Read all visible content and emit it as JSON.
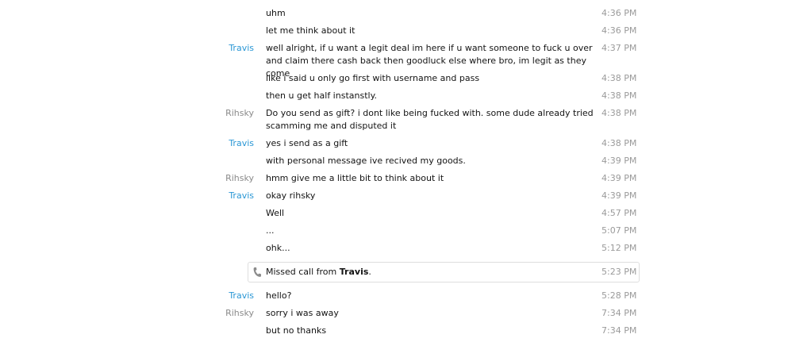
{
  "messages": [
    {
      "sender": "",
      "text": "uhm",
      "time": "4:36 PM"
    },
    {
      "sender": "",
      "text": "let me think about it",
      "time": "4:36 PM"
    },
    {
      "sender": "Travis",
      "text": "well alright, if u want a legit deal im here if u want someone to fuck u over and claim there cash back then goodluck else where bro, im legit as they come",
      "time": "4:37 PM"
    },
    {
      "sender": "",
      "text": "like i said u only go first with username and pass",
      "time": "4:38 PM"
    },
    {
      "sender": "",
      "text": "then u get half instanstly.",
      "time": "4:38 PM"
    },
    {
      "sender": "Rihsky",
      "text": "Do you send as gift? i dont like being fucked with. some dude already tried scamming me and disputed it",
      "time": "4:38 PM"
    },
    {
      "sender": "Travis",
      "text": "yes i send as a gift",
      "time": "4:38 PM"
    },
    {
      "sender": "",
      "text": "with personal message ive recived my goods.",
      "time": "4:39 PM"
    },
    {
      "sender": "Rihsky",
      "text": "hmm give me a little bit to think about it",
      "time": "4:39 PM"
    },
    {
      "sender": "Travis",
      "text": "okay rihsky",
      "time": "4:39 PM"
    },
    {
      "sender": "",
      "text": "Well",
      "time": "4:57 PM"
    },
    {
      "sender": "",
      "text": "...",
      "time": "5:07 PM"
    },
    {
      "sender": "",
      "text": "ohk...",
      "time": "5:12 PM"
    }
  ],
  "missed_call": {
    "prefix": "Missed call from ",
    "name": "Travis",
    "suffix": ".",
    "time": "5:23 PM",
    "icon": "phone-icon"
  },
  "messages_after": [
    {
      "sender": "Travis",
      "text": "hello?",
      "time": "5:28 PM"
    },
    {
      "sender": "Rihsky",
      "text": "sorry i was away",
      "time": "7:34 PM"
    },
    {
      "sender": "",
      "text": "but no thanks",
      "time": "7:34 PM"
    }
  ],
  "colors": {
    "travis": "#2a97d5",
    "rihsky": "#8a8a8a",
    "timestamp": "#9a9a9a",
    "text": "#141414"
  }
}
